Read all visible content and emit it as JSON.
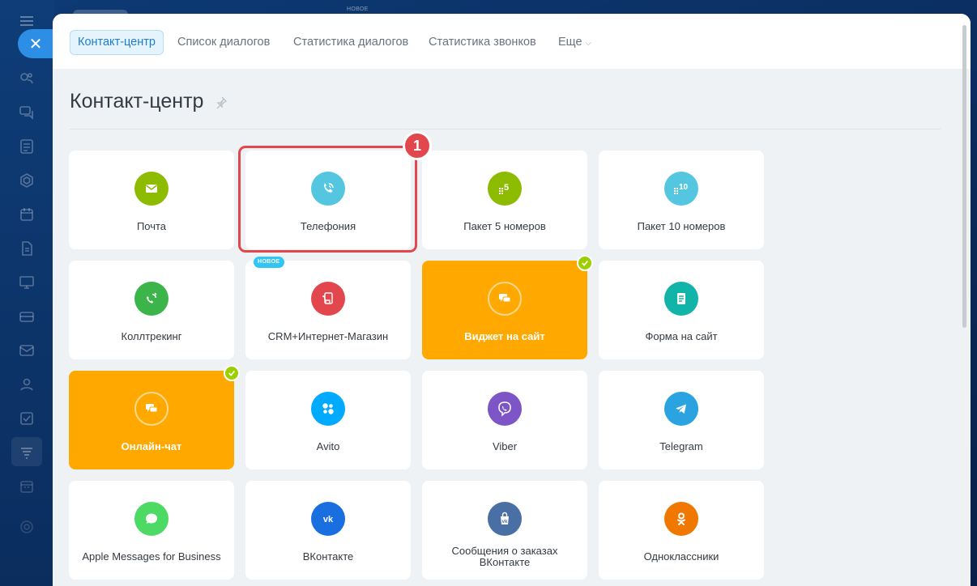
{
  "top_banner_badge": "НОВОЕ",
  "tabs": [
    {
      "label": "Контакт-центр",
      "active": true
    },
    {
      "label": "Список диалогов"
    },
    {
      "label": "Статистика диалогов"
    },
    {
      "label": "Статистика звонков"
    },
    {
      "label": "Еще"
    }
  ],
  "page_title": "Контакт-центр",
  "marker_label": "1",
  "new_badge": "НОВОЕ",
  "cards": [
    {
      "label": "Почта",
      "color": "#8dbb00",
      "icon": "mail-icon"
    },
    {
      "label": "Телефония",
      "color": "#55c6e0",
      "icon": "phone-icon"
    },
    {
      "label": "Пакет 5 номеров",
      "color": "#8dbb00",
      "icon": "dialpad-5-icon",
      "icon_text": "5"
    },
    {
      "label": "Пакет 10 номеров",
      "color": "#55c6e0",
      "icon": "dialpad-10-icon",
      "icon_text": "10"
    },
    {
      "label": "Коллтрекинг",
      "color": "#3bb44a",
      "icon": "calltracking-icon"
    },
    {
      "label": "CRM+Интернет-Магазин",
      "color": "#e2474e",
      "icon": "shop-cart-icon"
    },
    {
      "label": "Виджет на сайт",
      "color": "#ffa900",
      "icon": "chat-widget-icon",
      "connected": true
    },
    {
      "label": "Форма на сайт",
      "color": "#12b3a8",
      "icon": "form-icon"
    },
    {
      "label": "Онлайн-чат",
      "color": "#ffa900",
      "icon": "online-chat-icon",
      "connected": true
    },
    {
      "label": "Avito",
      "color": "#00aaff",
      "icon": "avito-icon"
    },
    {
      "label": "Viber",
      "color": "#7d55c7",
      "icon": "viber-icon"
    },
    {
      "label": "Telegram",
      "color": "#2aa3e0",
      "icon": "telegram-icon"
    },
    {
      "label": "Apple Messages for Business",
      "color": "#4cd964",
      "icon": "apple-messages-icon"
    },
    {
      "label": "ВКонтакте",
      "color": "#1a6fe0",
      "icon": "vk-icon"
    },
    {
      "label": "Сообщения о заказах ВКонтакте",
      "color": "#4a6fa5",
      "icon": "vk-orders-icon"
    },
    {
      "label": "Одноклассники",
      "color": "#f07800",
      "icon": "ok-icon"
    }
  ]
}
